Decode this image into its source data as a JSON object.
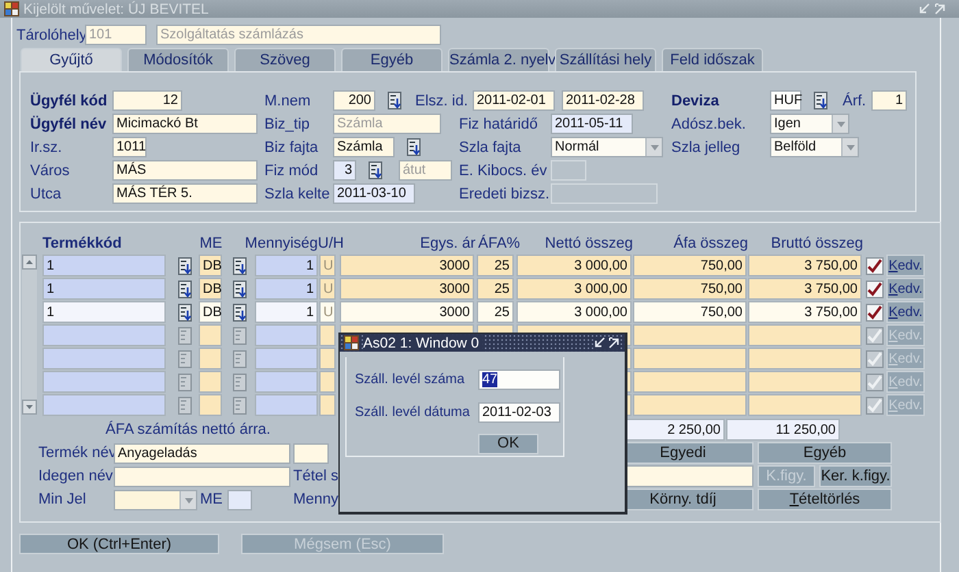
{
  "window": {
    "title": "Kijelölt művelet: ÚJ BEVITEL"
  },
  "storage": {
    "label": "Tárolóhely",
    "code": "101",
    "name": "Szolgáltatás számlázás"
  },
  "tabs": [
    {
      "label": "Gyűjtő",
      "selected": true
    },
    {
      "label": "Módosítók",
      "selected": false
    },
    {
      "label": "Szöveg",
      "selected": false
    },
    {
      "label": "Egyéb",
      "selected": false
    },
    {
      "label": "Számla 2. nyelv",
      "selected": false
    },
    {
      "label": "Szállítási hely",
      "selected": false
    },
    {
      "label": "Feld időszak",
      "selected": false
    }
  ],
  "header": {
    "columns": [
      [
        {
          "label": "Ügyfél kód",
          "required": true,
          "value": "12",
          "kind": "number"
        },
        {
          "label": "Ügyfél név",
          "required": true,
          "value": "Micimackó Bt",
          "kind": "text"
        },
        {
          "label": "Ir.sz.",
          "required": false,
          "value": "1011",
          "kind": "text"
        },
        {
          "label": "Város",
          "required": false,
          "value": "MÁS",
          "kind": "text"
        },
        {
          "label": "Utca",
          "required": false,
          "value": "MÁS TÉR 5.",
          "kind": "text"
        }
      ],
      [
        {
          "label": "M.nem",
          "required": false,
          "value": "200",
          "kind": "number",
          "lov": true
        },
        {
          "label": "Biz_tip",
          "required": false,
          "value": "Számla",
          "kind": "readonly"
        },
        {
          "label": "Biz fajta",
          "required": false,
          "value": "Számla",
          "kind": "text",
          "lov": true
        },
        {
          "label": "Fiz mód",
          "required": false,
          "value": "3",
          "kind": "display-number",
          "lov": true,
          "extra": {
            "kind": "readonly",
            "value": "átut"
          }
        },
        {
          "label": "Szla kelte",
          "required": false,
          "value": "2011-03-10",
          "kind": "display"
        }
      ],
      [
        {
          "label": "Elsz. id.",
          "required": false,
          "values": [
            "2011-02-01",
            "2011-02-28"
          ],
          "kind": "text"
        },
        {
          "label": "Fiz határidő",
          "required": false,
          "value": "2011-05-11",
          "kind": "display"
        },
        {
          "label": "Szla fajta",
          "required": false,
          "value": "Normál",
          "kind": "combo"
        },
        {
          "label": "E. Kibocs. év",
          "required": false,
          "kind": "disabled"
        },
        {
          "label": "Eredeti bizsz.",
          "required": false,
          "kind": "disabled"
        }
      ],
      [
        {
          "label": "Deviza",
          "required": true,
          "value": "HUF",
          "kind": "white",
          "lov": true,
          "extra": {
            "label": "Árf.",
            "kind": "number",
            "value": "1"
          }
        },
        {
          "label": "Adósz.bek.",
          "required": false,
          "value": "Igen",
          "kind": "combo"
        },
        {
          "label": "Szla jelleg",
          "required": false,
          "value": "Belföld",
          "kind": "combo"
        }
      ]
    ]
  },
  "items": {
    "columns": [
      "Termékkód",
      "ME",
      "Mennyiség",
      "U/H",
      "Egys. ár",
      "ÁFA%",
      "Nettó összeg",
      "Áfa összeg",
      "Bruttó összeg"
    ],
    "rows": [
      {
        "cells": [
          "1",
          "DB",
          "1",
          "U",
          "3000",
          "25",
          "3 000,00",
          "750,00",
          "3 750,00"
        ],
        "selected": false,
        "checked": true,
        "disabled": false,
        "button": {
          "label": "Kedv.",
          "mnemonic": true
        }
      },
      {
        "cells": [
          "1",
          "DB",
          "1",
          "U",
          "3000",
          "25",
          "3 000,00",
          "750,00",
          "3 750,00"
        ],
        "selected": false,
        "checked": true,
        "disabled": false,
        "button": {
          "label": "Kedv.",
          "mnemonic": true
        }
      },
      {
        "cells": [
          "1",
          "DB",
          "1",
          "U",
          "3000",
          "25",
          "3 000,00",
          "750,00",
          "3 750,00"
        ],
        "selected": true,
        "checked": true,
        "disabled": false,
        "button": {
          "label": "Kedv.",
          "mnemonic": true
        }
      },
      {
        "selected": false,
        "checked": true,
        "disabled": true,
        "button": {
          "label": "Kedv.",
          "mnemonic": true
        }
      },
      {
        "selected": false,
        "checked": true,
        "disabled": true,
        "button": {
          "label": "Kedv.",
          "mnemonic": true
        }
      },
      {
        "selected": false,
        "checked": true,
        "disabled": true,
        "button": {
          "label": "Kedv.",
          "mnemonic": true
        }
      },
      {
        "selected": false,
        "checked": true,
        "disabled": true,
        "button": {
          "label": "Kedv.",
          "mnemonic": true
        }
      }
    ],
    "note": "ÁFA számítás nettó árra.",
    "totals": [
      "2 250,00",
      "11 250,00"
    ]
  },
  "details": {
    "rows": [
      {
        "label": "Termék név",
        "field": {
          "kind": "text",
          "value": "Anyageladás"
        },
        "extra": {
          "kind": "field"
        }
      },
      {
        "label": "Idegen név",
        "field": {
          "kind": "text"
        },
        "extra": {
          "kind": "label",
          "text": "Tétel s"
        }
      },
      {
        "label": "Min Jel",
        "field": {
          "kind": "combo",
          "disabled": true
        },
        "unit": {
          "label": "ME",
          "kind": "display"
        },
        "extra": {
          "kind": "label",
          "text": "Menny"
        }
      }
    ]
  },
  "actions": [
    {
      "kind": "button",
      "label": "Egyedi",
      "disabled": false,
      "mnemonic": false
    },
    {
      "kind": "button",
      "label": "Egyéb",
      "disabled": false,
      "mnemonic": false
    },
    {
      "kind": "field"
    },
    {
      "kind": "button",
      "label": "K.figy.",
      "disabled": true,
      "mnemonic": false
    },
    {
      "kind": "button",
      "label": "Ker. k.figy.",
      "disabled": false,
      "mnemonic": false
    },
    {
      "kind": "button",
      "label": "Körny. tdíj",
      "disabled": false,
      "mnemonic": false
    },
    {
      "kind": "button",
      "label": "Tételtörlés",
      "disabled": false,
      "mnemonic": true
    }
  ],
  "footer": [
    {
      "label": "OK (Ctrl+Enter)",
      "disabled": false
    },
    {
      "label": "Mégsem (Esc)",
      "disabled": true
    }
  ],
  "dialog": {
    "title": "As02 1: Window 0",
    "fields": [
      {
        "label": "Száll. levél száma",
        "value": "47",
        "selected": true
      },
      {
        "label": "Száll. levél dátuma",
        "value": "2011-02-03",
        "selected": false
      }
    ],
    "button": "OK"
  }
}
